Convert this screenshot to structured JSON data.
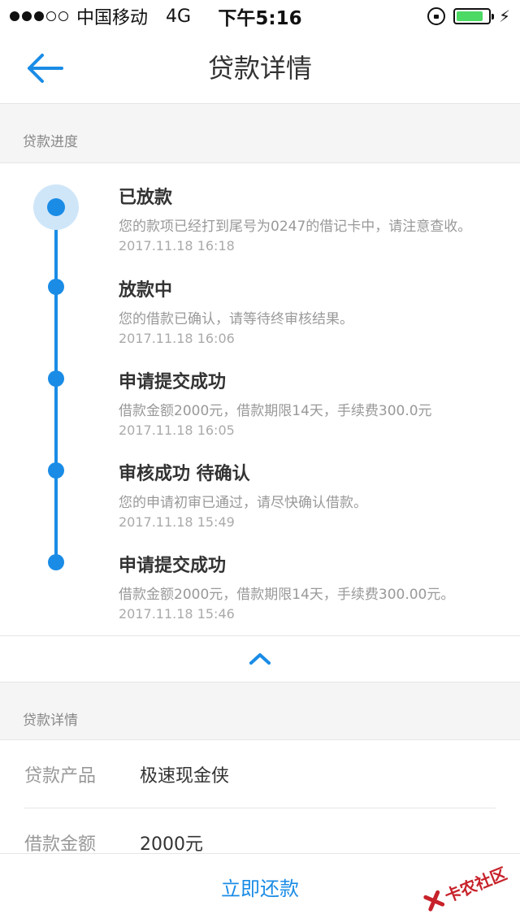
{
  "status_bar": {
    "carrier": "中国移动",
    "network": "4G",
    "time": "下午5:16",
    "signal_bars_total": 5,
    "signal_bars_active": 3,
    "battery_level": 0.85
  },
  "nav": {
    "title": "贷款详情",
    "back_icon": "arrow-left-icon"
  },
  "progress_section": {
    "header": "贷款进度",
    "steps": [
      {
        "title": "已放款",
        "desc": "您的款项已经打到尾号为0247的借记卡中，请注意查收。",
        "time": "2017.11.18 16:18"
      },
      {
        "title": "放款中",
        "desc": "您的借款已确认，请等待终审核结果。",
        "time": "2017.11.18 16:06"
      },
      {
        "title": "申请提交成功",
        "desc": "借款金额2000元，借款期限14天，手续费300.0元",
        "time": "2017.11.18 16:05"
      },
      {
        "title": "审核成功 待确认",
        "desc": "您的申请初审已通过，请尽快确认借款。",
        "time": "2017.11.18 15:49"
      },
      {
        "title": "申请提交成功",
        "desc": "借款金额2000元，借款期限14天，手续费300.00元。",
        "time": "2017.11.18 15:46"
      }
    ],
    "collapse_icon": "chevron-up-icon"
  },
  "details_section": {
    "header": "贷款详情",
    "rows": [
      {
        "label": "贷款产品",
        "value": "极速现金侠"
      },
      {
        "label": "借款金额",
        "value": "2000元"
      }
    ]
  },
  "bottom_bar": {
    "repay_label": "立即还款"
  },
  "watermark": {
    "text": "卡农社区"
  },
  "colors": {
    "accent": "#1a8ce6",
    "halo": "#cfe6f9",
    "battery": "#4cd964",
    "watermark": "#c7222a"
  }
}
